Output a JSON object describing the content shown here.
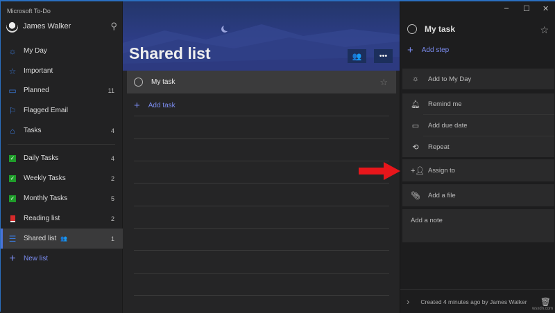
{
  "app": {
    "title": "Microsoft To-Do",
    "watermark": "wsxdn.com"
  },
  "user": {
    "name": "James Walker"
  },
  "sidebar": {
    "items": [
      {
        "label": "My Day",
        "count": ""
      },
      {
        "label": "Important",
        "count": ""
      },
      {
        "label": "Planned",
        "count": "11"
      },
      {
        "label": "Flagged Email",
        "count": ""
      },
      {
        "label": "Tasks",
        "count": "4"
      }
    ],
    "lists": [
      {
        "label": "Daily Tasks",
        "count": "4"
      },
      {
        "label": "Weekly Tasks",
        "count": "2"
      },
      {
        "label": "Monthly Tasks",
        "count": "5"
      },
      {
        "label": "Reading list",
        "count": "2"
      },
      {
        "label": "Shared list",
        "count": "1"
      }
    ],
    "new_list": "New list"
  },
  "main": {
    "title": "Shared list",
    "tasks": [
      {
        "title": "My task"
      }
    ],
    "add_task": "Add task"
  },
  "detail": {
    "task_title": "My task",
    "add_step": "Add step",
    "add_to_my_day": "Add to My Day",
    "remind_me": "Remind me",
    "add_due_date": "Add due date",
    "repeat": "Repeat",
    "assign_to": "Assign to",
    "add_file": "Add a file",
    "add_note": "Add a note",
    "footer": "Created 4 minutes ago by James Walker"
  },
  "colors": {
    "accent": "#7b8cf0",
    "arrow": "#e8161b"
  }
}
